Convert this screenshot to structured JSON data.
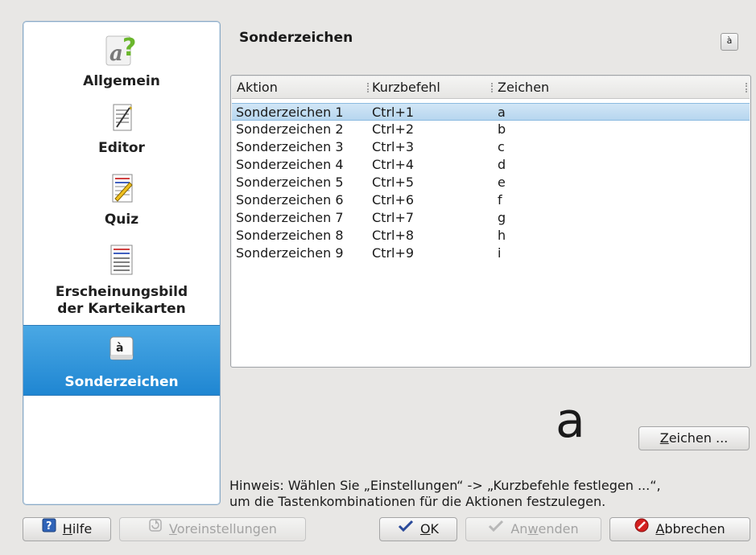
{
  "sidebar": {
    "items": [
      {
        "label": "Allgemein",
        "icon": "general-icon"
      },
      {
        "label": "Editor",
        "icon": "editor-icon"
      },
      {
        "label": "Quiz",
        "icon": "quiz-icon"
      },
      {
        "label": "Erscheinungsbild der Karteikarten",
        "label_line1": "Erscheinungsbild",
        "label_line2": "der Karteikarten",
        "icon": "cardlook-icon"
      },
      {
        "label": "Sonderzeichen",
        "icon": "special-chars-icon",
        "selected": true
      }
    ]
  },
  "page": {
    "title": "Sonderzeichen",
    "corner_icon_glyph": "à"
  },
  "table": {
    "columns": [
      "Aktion",
      "Kurzbefehl",
      "Zeichen"
    ],
    "rows": [
      [
        "Sonderzeichen 1",
        "Ctrl+1",
        "a"
      ],
      [
        "Sonderzeichen 2",
        "Ctrl+2",
        "b"
      ],
      [
        "Sonderzeichen 3",
        "Ctrl+3",
        "c"
      ],
      [
        "Sonderzeichen 4",
        "Ctrl+4",
        "d"
      ],
      [
        "Sonderzeichen 5",
        "Ctrl+5",
        "e"
      ],
      [
        "Sonderzeichen 6",
        "Ctrl+6",
        "f"
      ],
      [
        "Sonderzeichen 7",
        "Ctrl+7",
        "g"
      ],
      [
        "Sonderzeichen 8",
        "Ctrl+8",
        "h"
      ],
      [
        "Sonderzeichen 9",
        "Ctrl+9",
        "i"
      ]
    ],
    "selected_row": 0
  },
  "preview": {
    "char": "a"
  },
  "buttons": {
    "zeichen": {
      "mn": "Z",
      "rest": "eichen ..."
    },
    "hilfe": {
      "mn": "H",
      "rest": "ilfe"
    },
    "voreinstellungen": {
      "mn": "V",
      "rest": "oreinstellungen"
    },
    "ok": {
      "mn": "O",
      "rest": "K"
    },
    "anwenden": {
      "pre": "An",
      "mn": "w",
      "rest": "enden"
    },
    "abbrechen": {
      "mn": "A",
      "rest": "bbrechen"
    }
  },
  "hint": {
    "line1": "Hinweis: Wählen Sie „Einstellungen“ -> „Kurzbefehle festlegen ...“,",
    "line2": "um die Tastenkombinationen für die Aktionen festzulegen."
  },
  "colors": {
    "accent": "#2a8fd8",
    "selection": "#c6def2"
  }
}
